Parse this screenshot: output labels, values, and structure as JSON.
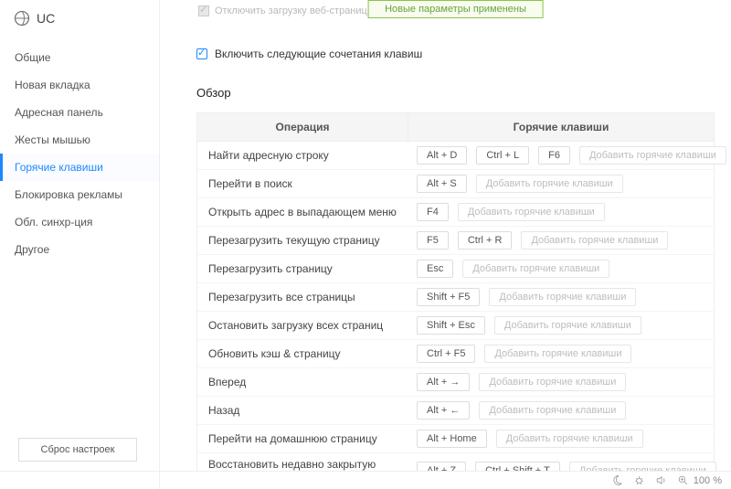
{
  "brand": "UC",
  "toast": "Новые параметры применены",
  "disabled_check_label": "Отключить загрузку веб-страницы при нажатии Bosskey",
  "enable_label": "Включить следующие сочетания клавиш",
  "section_title": "Обзор",
  "sidebar": {
    "items": [
      {
        "label": "Общие"
      },
      {
        "label": "Новая вкладка"
      },
      {
        "label": "Адресная панель"
      },
      {
        "label": "Жесты мышью"
      },
      {
        "label": "Горячие клавиши"
      },
      {
        "label": "Блокировка рекламы"
      },
      {
        "label": "Обл. синхр-ция"
      },
      {
        "label": "Другое"
      }
    ],
    "reset": "Сброс настроек"
  },
  "table": {
    "col_op": "Операция",
    "col_hk": "Горячие клавиши",
    "add_label": "Добавить горячие клавиши",
    "rows": [
      {
        "op": "Найти адресную строку",
        "keys": [
          "Alt + D",
          "Ctrl + L",
          "F6"
        ]
      },
      {
        "op": "Перейти в поиск",
        "keys": [
          "Alt + S"
        ]
      },
      {
        "op": "Открыть адрес в выпадающем меню",
        "keys": [
          "F4"
        ]
      },
      {
        "op": "Перезагрузить текущую страницу",
        "keys": [
          "F5",
          "Ctrl + R"
        ]
      },
      {
        "op": "Перезагрузить страницу",
        "keys": [
          "Esc"
        ]
      },
      {
        "op": "Перезагрузить все страницы",
        "keys": [
          "Shift + F5"
        ]
      },
      {
        "op": "Остановить загрузку всех страниц",
        "keys": [
          "Shift + Esc"
        ]
      },
      {
        "op": "Обновить кэш & страницу",
        "keys": [
          "Ctrl + F5"
        ]
      },
      {
        "op": "Вперед",
        "keys": [
          "Alt + →"
        ]
      },
      {
        "op": "Назад",
        "keys": [
          "Alt + ←"
        ]
      },
      {
        "op": "Перейти на домашнюю страницу",
        "keys": [
          "Alt + Home"
        ]
      },
      {
        "op": "Восстановить недавно закрытую вкладку",
        "keys": [
          "Alt + Z",
          "Ctrl + Shift + T"
        ]
      }
    ]
  },
  "status": {
    "zoom": "100 %"
  }
}
